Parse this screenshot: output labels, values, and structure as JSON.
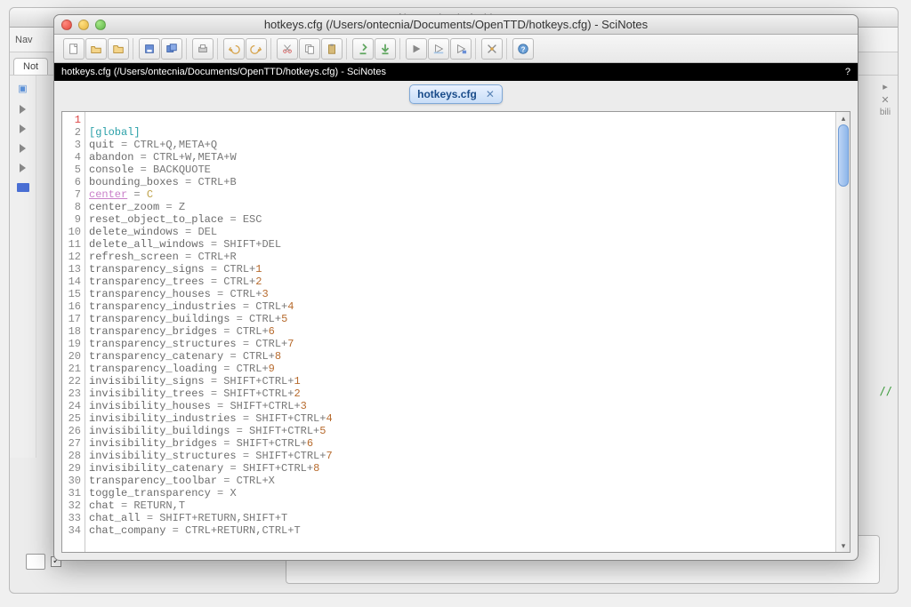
{
  "background": {
    "title": "Navegador de Archivos",
    "nav_label": "Nav",
    "nom_label": "Not",
    "tab_suffix": "bili",
    "comment": "//"
  },
  "window": {
    "title": "hotkeys.cfg (/Users/ontecnia/Documents/OpenTTD/hotkeys.cfg) - SciNotes",
    "blackbar": "hotkeys.cfg (/Users/ontecnia/Documents/OpenTTD/hotkeys.cfg) - SciNotes",
    "help_q": "?",
    "tab_name": "hotkeys.cfg",
    "tab_close": "✕"
  },
  "code_lines": [
    {
      "n": 1,
      "html": ""
    },
    {
      "n": 2,
      "html": "<span class='sect'>[global]</span>"
    },
    {
      "n": 3,
      "html": "<span class='key'>quit</span> <span class='eq'>=</span> <span class='val'>CTRL+Q,META+Q</span>"
    },
    {
      "n": 4,
      "html": "<span class='key'>abandon</span> <span class='eq'>=</span> <span class='val'>CTRL+W,META+W</span>"
    },
    {
      "n": 5,
      "html": "<span class='key'>console</span> <span class='eq'>=</span> <span class='val'>BACKQUOTE</span>"
    },
    {
      "n": 6,
      "html": "<span class='key'>bounding_boxes</span> <span class='eq'>=</span> <span class='val'>CTRL+B</span>"
    },
    {
      "n": 7,
      "html": "<span class='link'>center</span> <span class='eq'>=</span> <span class='lv'>C</span>"
    },
    {
      "n": 8,
      "html": "<span class='key'>center_zoom</span> <span class='eq'>=</span> <span class='val'>Z</span>"
    },
    {
      "n": 9,
      "html": "<span class='key'>reset_object_to_place</span> <span class='eq'>=</span> <span class='val'>ESC</span>"
    },
    {
      "n": 10,
      "html": "<span class='key'>delete_windows</span> <span class='eq'>=</span> <span class='val'>DEL</span>"
    },
    {
      "n": 11,
      "html": "<span class='key'>delete_all_windows</span> <span class='eq'>=</span> <span class='val'>SHIFT+DEL</span>"
    },
    {
      "n": 12,
      "html": "<span class='key'>refresh_screen</span> <span class='eq'>=</span> <span class='val'>CTRL+R</span>"
    },
    {
      "n": 13,
      "html": "<span class='key'>transparency_signs</span> <span class='eq'>=</span> <span class='val'>CTRL+</span><span class='num'>1</span>"
    },
    {
      "n": 14,
      "html": "<span class='key'>transparency_trees</span> <span class='eq'>=</span> <span class='val'>CTRL+</span><span class='num'>2</span>"
    },
    {
      "n": 15,
      "html": "<span class='key'>transparency_houses</span> <span class='eq'>=</span> <span class='val'>CTRL+</span><span class='num'>3</span>"
    },
    {
      "n": 16,
      "html": "<span class='key'>transparency_industries</span> <span class='eq'>=</span> <span class='val'>CTRL+</span><span class='num'>4</span>"
    },
    {
      "n": 17,
      "html": "<span class='key'>transparency_buildings</span> <span class='eq'>=</span> <span class='val'>CTRL+</span><span class='num'>5</span>"
    },
    {
      "n": 18,
      "html": "<span class='key'>transparency_bridges</span> <span class='eq'>=</span> <span class='val'>CTRL+</span><span class='num'>6</span>"
    },
    {
      "n": 19,
      "html": "<span class='key'>transparency_structures</span> <span class='eq'>=</span> <span class='val'>CTRL+</span><span class='num'>7</span>"
    },
    {
      "n": 20,
      "html": "<span class='key'>transparency_catenary</span> <span class='eq'>=</span> <span class='val'>CTRL+</span><span class='num'>8</span>"
    },
    {
      "n": 21,
      "html": "<span class='key'>transparency_loading</span> <span class='eq'>=</span> <span class='val'>CTRL+</span><span class='num'>9</span>"
    },
    {
      "n": 22,
      "html": "<span class='key'>invisibility_signs</span> <span class='eq'>=</span> <span class='val'>SHIFT+CTRL+</span><span class='num'>1</span>"
    },
    {
      "n": 23,
      "html": "<span class='key'>invisibility_trees</span> <span class='eq'>=</span> <span class='val'>SHIFT+CTRL+</span><span class='num'>2</span>"
    },
    {
      "n": 24,
      "html": "<span class='key'>invisibility_houses</span> <span class='eq'>=</span> <span class='val'>SHIFT+CTRL+</span><span class='num'>3</span>"
    },
    {
      "n": 25,
      "html": "<span class='key'>invisibility_industries</span> <span class='eq'>=</span> <span class='val'>SHIFT+CTRL+</span><span class='num'>4</span>"
    },
    {
      "n": 26,
      "html": "<span class='key'>invisibility_buildings</span> <span class='eq'>=</span> <span class='val'>SHIFT+CTRL+</span><span class='num'>5</span>"
    },
    {
      "n": 27,
      "html": "<span class='key'>invisibility_bridges</span> <span class='eq'>=</span> <span class='val'>SHIFT+CTRL+</span><span class='num'>6</span>"
    },
    {
      "n": 28,
      "html": "<span class='key'>invisibility_structures</span> <span class='eq'>=</span> <span class='val'>SHIFT+CTRL+</span><span class='num'>7</span>"
    },
    {
      "n": 29,
      "html": "<span class='key'>invisibility_catenary</span> <span class='eq'>=</span> <span class='val'>SHIFT+CTRL+</span><span class='num'>8</span>"
    },
    {
      "n": 30,
      "html": "<span class='key'>transparency_toolbar</span> <span class='eq'>=</span> <span class='val'>CTRL+X</span>"
    },
    {
      "n": 31,
      "html": "<span class='key'>toggle_transparency</span> <span class='eq'>=</span> <span class='val'>X</span>"
    },
    {
      "n": 32,
      "html": "<span class='key'>chat</span> <span class='eq'>=</span> <span class='val'>RETURN,T</span>"
    },
    {
      "n": 33,
      "html": "<span class='key'>chat_all</span> <span class='eq'>=</span> <span class='val'>SHIFT+RETURN,SHIFT+T</span>"
    },
    {
      "n": 34,
      "html": "<span class='key'>chat_company</span> <span class='eq'>=</span> <span class='val'>CTRL+RETURN,CTRL+T</span>"
    }
  ]
}
